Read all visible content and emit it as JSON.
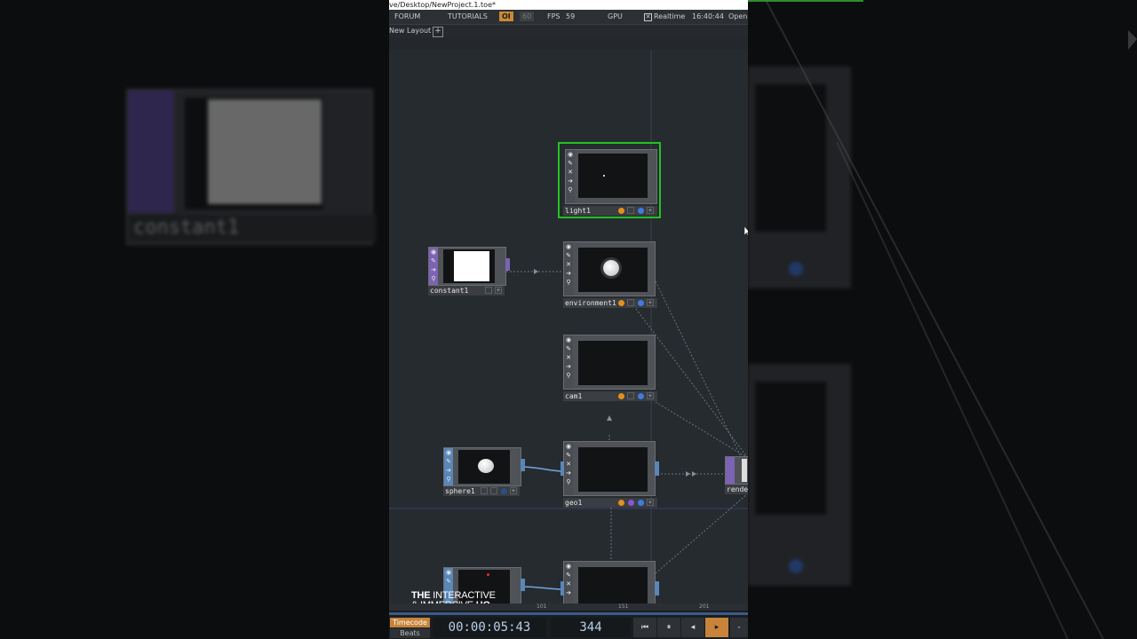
{
  "window": {
    "title": "ve/Desktop/NewProject.1.toe*"
  },
  "menubar": {
    "forum": "FORUM",
    "tutorials": "TUTORIALS",
    "oi": "OI",
    "fps_target": "60",
    "fps_label": "FPS",
    "fps_value": "59",
    "gpu": "GPU",
    "realtime": "Realtime",
    "clock": "16:40:44",
    "open": "Open"
  },
  "layout": {
    "tab_label": "New Layout",
    "add": "+"
  },
  "nodes": {
    "light1": "light1",
    "constant1": "constant1",
    "environment1": "environment1",
    "cam1": "cam1",
    "sphere1": "sphere1",
    "geo1": "geo1",
    "render": "rende"
  },
  "node_icons": [
    "eye-icon",
    "pencil-icon",
    "cross-icon",
    "arrow-icon",
    "wrench-icon"
  ],
  "watermark": {
    "line1_bold": "THE",
    "line1_rest": " INTERACTIVE",
    "line2_rest": "& IMMERSIVE ",
    "line2_bold": "HQ"
  },
  "timeline": {
    "ticks": [
      "101",
      "151",
      "201"
    ],
    "timecode_label": "Timecode",
    "beats_label": "Beats",
    "timecode": "00:00:05:43",
    "frame": "344"
  },
  "background_left": {
    "label": "constant1"
  },
  "colors": {
    "selected": "#22c322",
    "op_purple": "#7c63b4",
    "op_blue": "#5a86b8",
    "flag_orange": "#e0901e",
    "flag_blue": "#3f7ce0",
    "flag_purple": "#8a55d6"
  }
}
